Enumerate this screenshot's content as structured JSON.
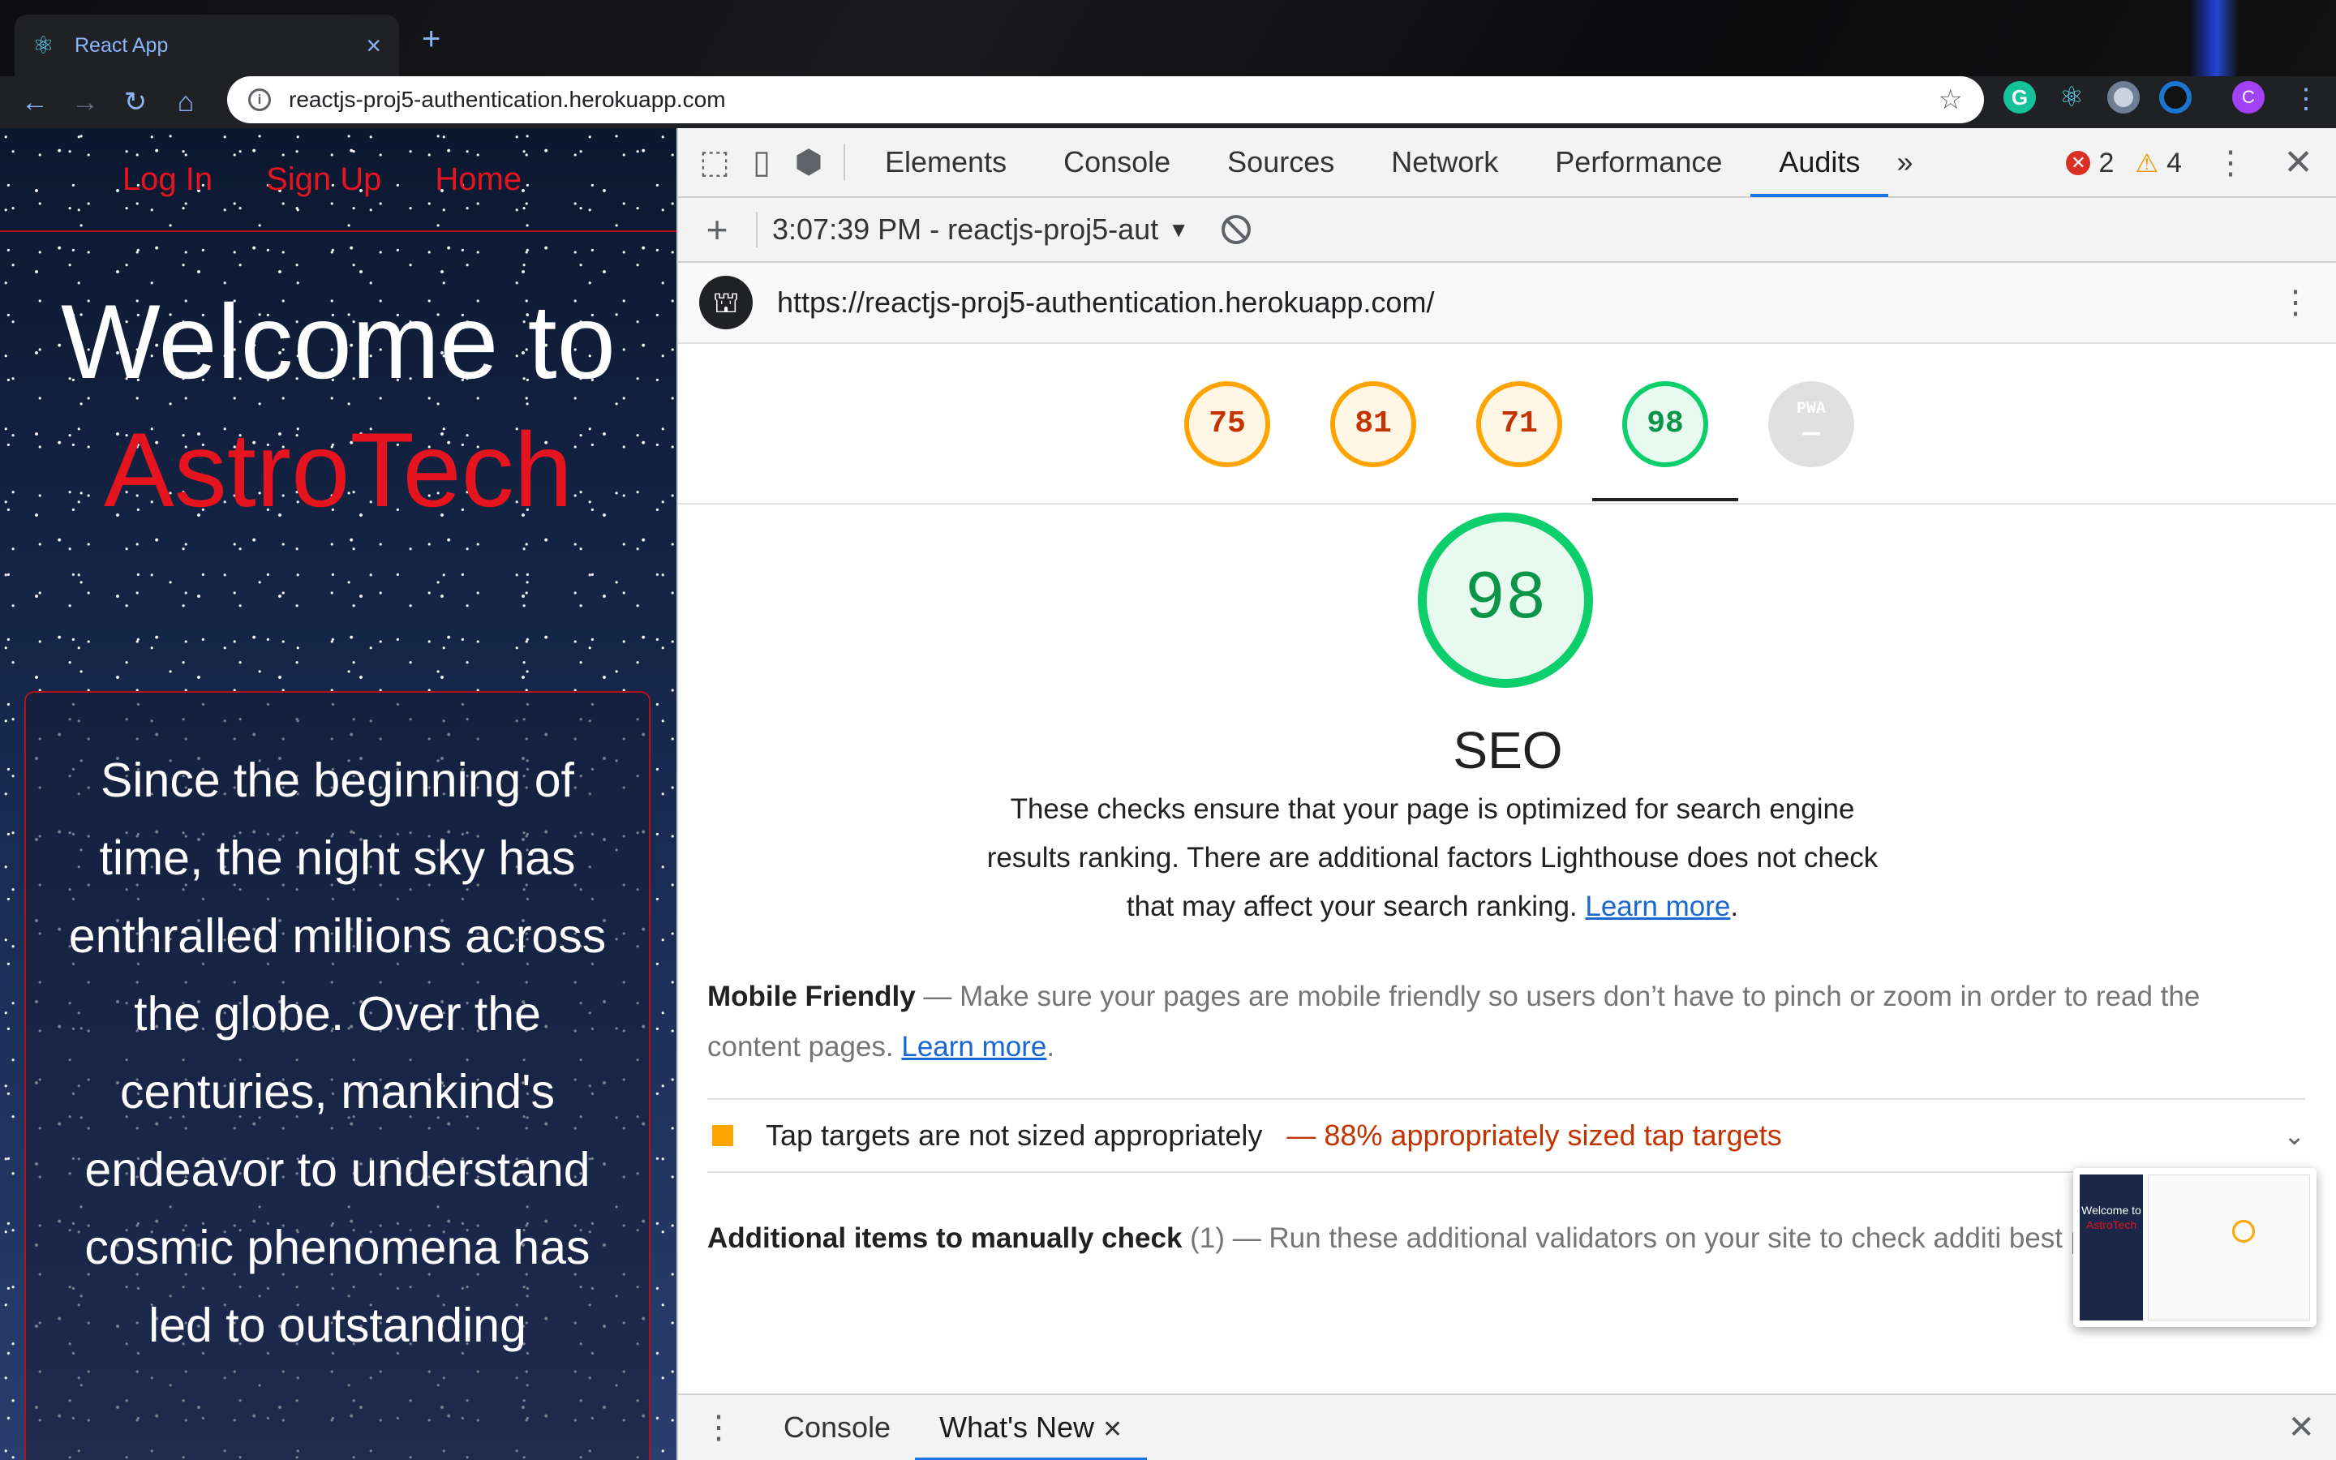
{
  "browser": {
    "tab_title": "React App",
    "tab_icon": "react-icon",
    "url": "reactjs-proj5-authentication.herokuapp.com",
    "extensions": [
      "grammarly-icon",
      "react-devtools-icon",
      "extension-icon",
      "extension-icon",
      "profile-avatar"
    ],
    "profile_initial": "C"
  },
  "site": {
    "nav": [
      "Log In",
      "Sign Up",
      "Home"
    ],
    "hero_line1": "Welcome to",
    "hero_line2": "AstroTech",
    "intro": "Since the beginning of time, the night sky has enthralled millions across the globe. Over the centuries, mankind's endeavor to understand cosmic phenomena has led to outstanding"
  },
  "devtools": {
    "tabs": [
      "Elements",
      "Console",
      "Sources",
      "Network",
      "Performance",
      "Audits"
    ],
    "active_tab": "Audits",
    "more_tabs": "»",
    "errors": "2",
    "warnings": "4",
    "report_select": "3:07:39 PM - reactjs-proj5-aut",
    "audited_url": "https://reactjs-proj5-authentication.herokuapp.com/",
    "scores": [
      {
        "value": "75",
        "status": "average"
      },
      {
        "value": "81",
        "status": "average"
      },
      {
        "value": "71",
        "status": "average"
      },
      {
        "value": "98",
        "status": "good"
      },
      {
        "value": "PWA",
        "status": "na"
      }
    ],
    "category": {
      "score": "98",
      "title": "SEO",
      "description": "These checks ensure that your page is optimized for search engine results ranking. There are additional factors Lighthouse does not check that may affect your search ranking.",
      "learn_more": "Learn more"
    },
    "mobile_group": {
      "title": "Mobile Friendly",
      "description": "Make sure your pages are mobile friendly so users don’t have to pinch or zoom in order to read the content pages.",
      "learn_more": "Learn more"
    },
    "audit": {
      "title": "Tap targets are not sized appropriately",
      "display": "88% appropriately sized tap targets"
    },
    "manual_group": {
      "title": "Additional items to manually check",
      "count": "(1)",
      "description": "Run these additional validators on your site to check additi best practices."
    },
    "drawer_tabs": [
      "Console",
      "What's New"
    ],
    "active_drawer_tab": "What's New"
  },
  "thumbnail": {
    "line1": "Welcome to",
    "line2": "AstroTech"
  },
  "colors": {
    "accent_red": "#e5141f",
    "lighthouse_average": "#ffa400",
    "lighthouse_good": "#0cce6b",
    "devtools_active_tab": "#1a73e8"
  }
}
